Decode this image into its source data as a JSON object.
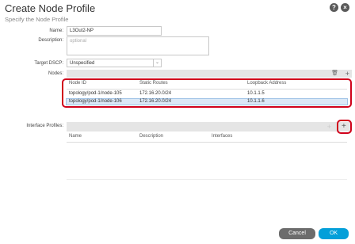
{
  "dialog": {
    "title": "Create Node Profile",
    "subtitle": "Specify the Node Profile"
  },
  "header_icons": {
    "help": "?",
    "close": "×"
  },
  "form": {
    "name_label": "Name:",
    "name_value": "L3Out2-NP",
    "description_label": "Description:",
    "description_placeholder": "optional",
    "target_dscp_label": "Target DSCP:",
    "target_dscp_value": "Unspecified",
    "nodes_label": "Nodes:",
    "interface_profiles_label": "Interface Profiles:"
  },
  "nodes_table": {
    "columns": [
      "Node ID",
      "Static Routes",
      "Loopback Address"
    ],
    "rows": [
      [
        "topology/pod-1/node-105",
        "172.16.20.0/24",
        "10.1.1.5"
      ],
      [
        "topology/pod-1/node-106",
        "172.16.20.0/24",
        "10.1.1.6"
      ]
    ]
  },
  "interface_table": {
    "columns": [
      "Name",
      "Description",
      "Interfaces"
    ]
  },
  "toolbar_icons": {
    "delete": "trash-icon",
    "add": "+"
  },
  "buttons": {
    "cancel": "Cancel",
    "ok": "OK"
  },
  "colors": {
    "highlight": "#d0021b",
    "ok": "#049fd9",
    "cancel": "#6c6c6c"
  }
}
